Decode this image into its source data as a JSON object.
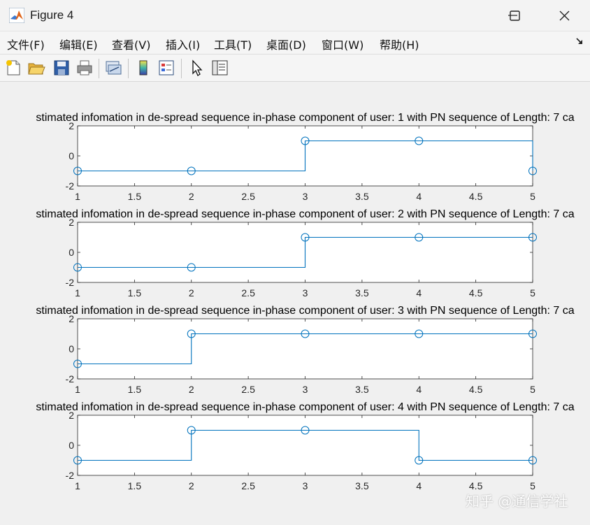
{
  "window": {
    "title": "Figure 4",
    "icon": "matlab-logo-icon"
  },
  "menubar": {
    "items": [
      {
        "label": "文件(F)"
      },
      {
        "label": "编辑(E)"
      },
      {
        "label": "查看(V)"
      },
      {
        "label": "插入(I)"
      },
      {
        "label": "工具(T)"
      },
      {
        "label": "桌面(D)"
      },
      {
        "label": "窗口(W)"
      },
      {
        "label": "帮助(H)"
      }
    ]
  },
  "toolbar": {
    "buttons": [
      "new-figure-icon",
      "open-file-icon",
      "save-icon",
      "print-icon",
      "link-plot-icon",
      "insert-colorbar-icon",
      "insert-legend-icon",
      "edit-plot-arrow-icon",
      "property-inspector-icon"
    ]
  },
  "chart_data": [
    {
      "type": "line",
      "style": "stairs-with-circle-markers",
      "title": "stimated infomation in de-spread sequence in-phase component of user: 1 with PN sequence of Length: 7  ca",
      "x": [
        1,
        2,
        3,
        4,
        5
      ],
      "y": [
        -1,
        -1,
        1,
        1,
        -1
      ],
      "xlim": [
        1,
        5
      ],
      "ylim": [
        -2,
        2
      ],
      "xticks": [
        "1",
        "1.5",
        "2",
        "2.5",
        "3",
        "3.5",
        "4",
        "4.5",
        "5"
      ],
      "yticks": [
        "-2",
        "0",
        "2"
      ],
      "color": "#0072bd",
      "grid": false
    },
    {
      "type": "line",
      "style": "stairs-with-circle-markers",
      "title": "stimated infomation in de-spread sequence in-phase component of user: 2 with PN sequence of Length: 7  ca",
      "x": [
        1,
        2,
        3,
        4,
        5
      ],
      "y": [
        -1,
        -1,
        1,
        1,
        1
      ],
      "xlim": [
        1,
        5
      ],
      "ylim": [
        -2,
        2
      ],
      "xticks": [
        "1",
        "1.5",
        "2",
        "2.5",
        "3",
        "3.5",
        "4",
        "4.5",
        "5"
      ],
      "yticks": [
        "-2",
        "0",
        "2"
      ],
      "color": "#0072bd",
      "grid": false
    },
    {
      "type": "line",
      "style": "stairs-with-circle-markers",
      "title": "stimated infomation in de-spread sequence in-phase component of user: 3 with PN sequence of Length: 7  ca",
      "x": [
        1,
        2,
        3,
        4,
        5
      ],
      "y": [
        -1,
        1,
        1,
        1,
        1
      ],
      "xlim": [
        1,
        5
      ],
      "ylim": [
        -2,
        2
      ],
      "xticks": [
        "1",
        "1.5",
        "2",
        "2.5",
        "3",
        "3.5",
        "4",
        "4.5",
        "5"
      ],
      "yticks": [
        "-2",
        "0",
        "2"
      ],
      "color": "#0072bd",
      "grid": false
    },
    {
      "type": "line",
      "style": "stairs-with-circle-markers",
      "title": "stimated infomation in de-spread sequence in-phase component of user: 4 with PN sequence of Length: 7  ca",
      "x": [
        1,
        2,
        3,
        4,
        5
      ],
      "y": [
        -1,
        1,
        1,
        -1,
        -1
      ],
      "xlim": [
        1,
        5
      ],
      "ylim": [
        -2,
        2
      ],
      "xticks": [
        "1",
        "1.5",
        "2",
        "2.5",
        "3",
        "3.5",
        "4",
        "4.5",
        "5"
      ],
      "yticks": [
        "-2",
        "0",
        "2"
      ],
      "color": "#0072bd",
      "grid": false
    }
  ],
  "watermark": {
    "text": "知乎 @通信学社"
  }
}
